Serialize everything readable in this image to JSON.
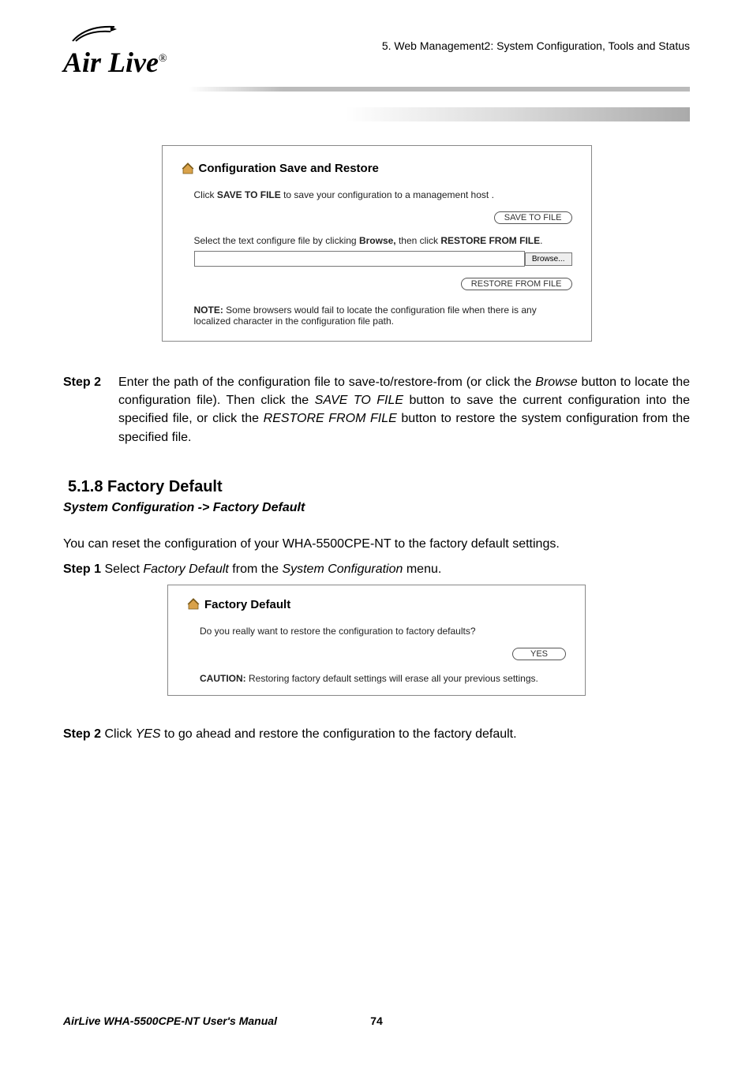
{
  "header": {
    "logo_text": "Air Live",
    "chapter": "5.  Web  Management2:  System  Configuration,  Tools  and  Status"
  },
  "panel1": {
    "title": "Configuration Save and Restore",
    "line1_pre": "Click ",
    "line1_bold": "SAVE TO FILE",
    "line1_post": " to save your configuration to a management host .",
    "btn_save": "SAVE TO FILE",
    "line2_pre": "Select the text configure file by clicking ",
    "line2_bold1": "Browse,",
    "line2_mid": " then click ",
    "line2_bold2": "RESTORE FROM FILE",
    "line2_end": ".",
    "browse": "Browse...",
    "btn_restore": "RESTORE FROM FILE",
    "note_label": "NOTE:",
    "note_text": " Some browsers would fail to locate the configuration file when there is any localized character in the configuration file path."
  },
  "step2a": {
    "label": "Step 2",
    "text_pre": "Enter the path of the configuration file to save-to/restore-from (or click the ",
    "browse_i": "Browse",
    "text_mid1": " button to locate the configuration file). Then click the ",
    "save_i": "SAVE TO FILE",
    "text_mid2": " button to save the current configuration into the specified file, or click the ",
    "restore_i": "RESTORE FROM FILE",
    "text_end": " button to restore the system configuration from the specified file."
  },
  "section": {
    "heading": "5.1.8 Factory Default",
    "path": "System Configuration -> Factory Default",
    "desc": "You can reset the configuration of your WHA-5500CPE-NT to the factory default settings.",
    "step1_label": "Step 1",
    "step1_pre": " Select ",
    "step1_i1": "Factory Default",
    "step1_mid": " from the ",
    "step1_i2": "System Configuration",
    "step1_end": " menu."
  },
  "panel2": {
    "title": "Factory Default",
    "question": "Do you really want to restore the configuration to factory defaults?",
    "btn_yes": "YES",
    "caution_label": "CAUTION:",
    "caution_text": " Restoring factory default settings will erase all your previous settings."
  },
  "step2b": {
    "label": "Step 2",
    "pre": " Click ",
    "yes_i": "YES",
    "post": " to go ahead and restore the configuration to the factory default."
  },
  "footer": {
    "title": "AirLive WHA-5500CPE-NT User's Manual",
    "page": "74"
  }
}
